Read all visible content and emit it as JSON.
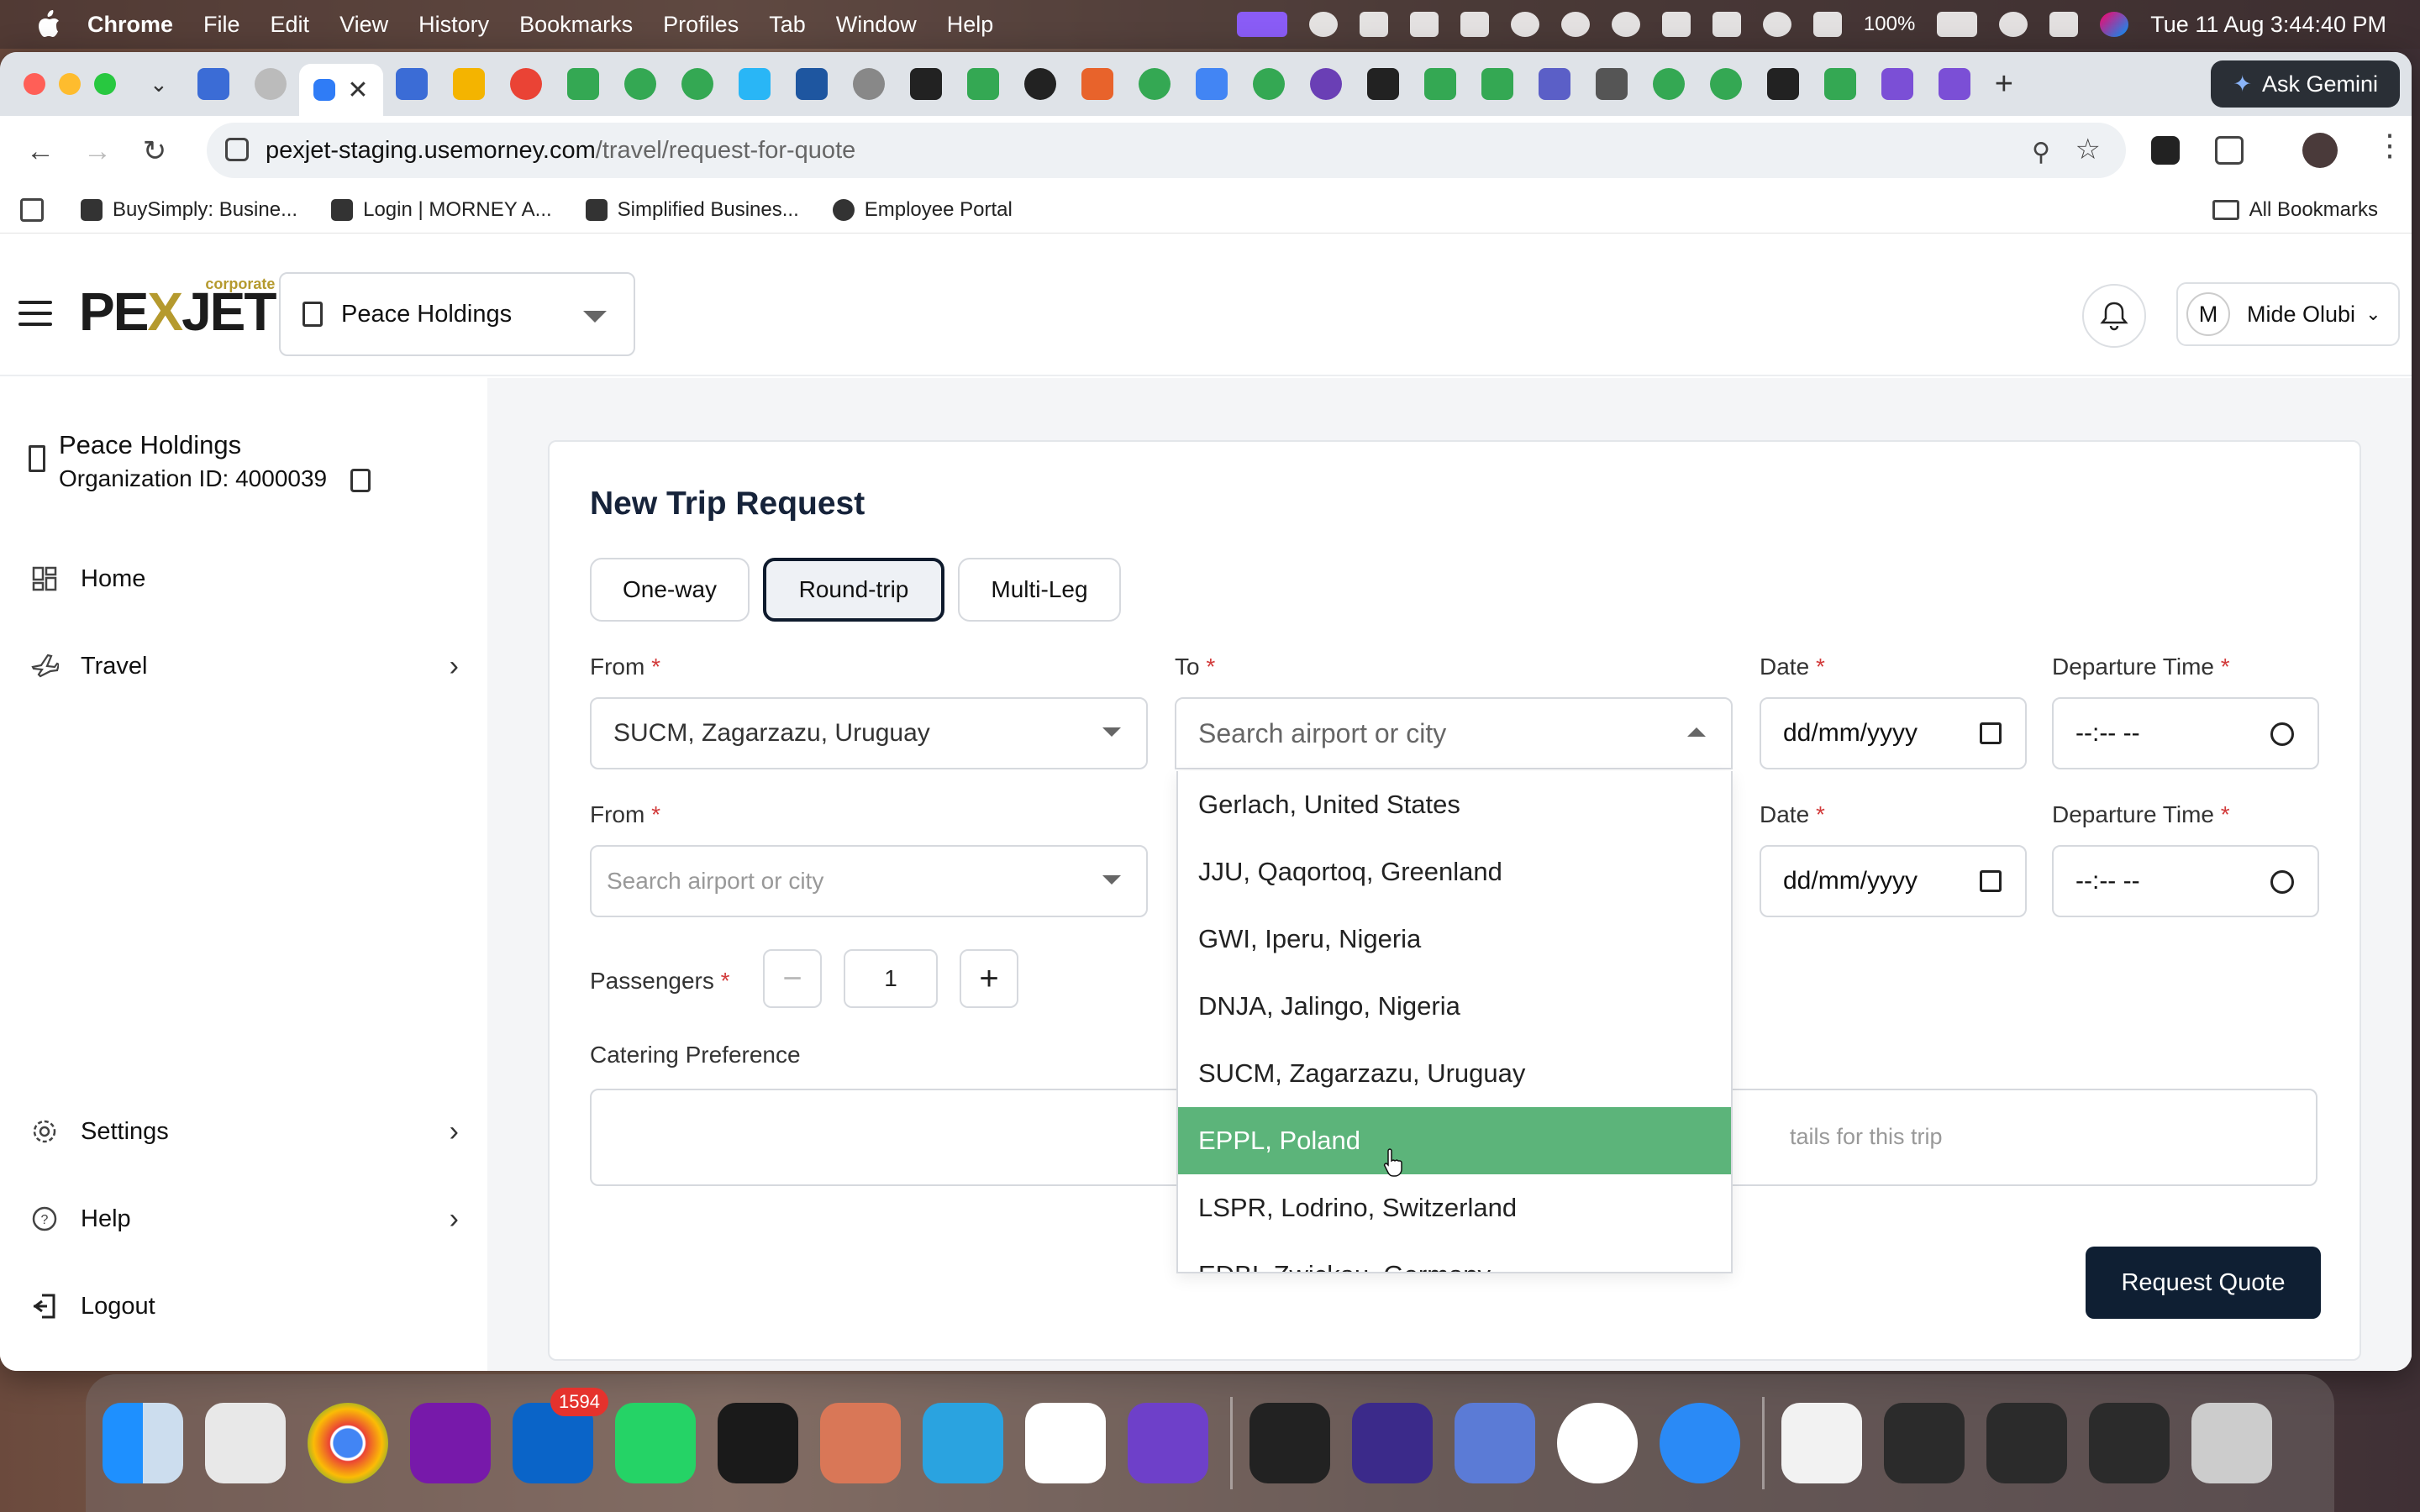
{
  "menubar": {
    "app": "Chrome",
    "items": [
      "File",
      "Edit",
      "View",
      "History",
      "Bookmarks",
      "Profiles",
      "Tab",
      "Window",
      "Help"
    ],
    "battery": "100%",
    "datetime": "Tue 11 Aug  3:44:40 PM"
  },
  "browser": {
    "ask_gemini": "Ask Gemini",
    "url_host": "pexjet-staging.usemorney.com",
    "url_path": "/travel/request-for-quote",
    "bookmarks": [
      "BuySimply: Busine...",
      "Login | MORNEY A...",
      "Simplified Busines...",
      "Employee Portal"
    ],
    "all_bookmarks": "All Bookmarks"
  },
  "header": {
    "logo_left": "PE",
    "logo_x": "X",
    "logo_right": "JET",
    "logo_tag": "corporate",
    "org_name": "Peace Holdings",
    "user_initial": "M",
    "user_name": "Mide Olubi"
  },
  "sidebar": {
    "org_name": "Peace Holdings",
    "org_id": "Organization ID: 4000039",
    "home": "Home",
    "travel": "Travel",
    "settings": "Settings",
    "help": "Help",
    "logout": "Logout"
  },
  "form": {
    "title": "New Trip Request",
    "tabs": [
      "One-way",
      "Round-trip",
      "Multi-Leg"
    ],
    "active_tab": "Round-trip",
    "from_label": "From",
    "to_label": "To",
    "date_label": "Date",
    "departure_label": "Departure Time",
    "required_mark": "*",
    "from_value": "SUCM, Zagarzazu, Uruguay",
    "to_placeholder": "Search airport or city",
    "from2_placeholder": "Search airport or city",
    "date_placeholder": "dd/mm/yyyy",
    "time_placeholder": "--:-- --",
    "passengers_label": "Passengers",
    "passengers": "1",
    "minus": "−",
    "plus": "+",
    "catering_label": "Catering Preference",
    "catering_placeholder_partial": "tails for this trip",
    "submit": "Request Quote"
  },
  "dropdown": {
    "options": [
      "Gerlach, United States",
      "JJU, Qaqortoq, Greenland",
      "GWI, Iperu, Nigeria",
      "DNJA, Jalingo, Nigeria",
      "SUCM, Zagarzazu, Uruguay",
      "EPPL, Poland",
      "LSPR, Lodrino, Switzerland",
      "EDBI, Zwickau, Germany"
    ],
    "highlighted": "EPPL, Poland"
  },
  "dock": {
    "mail_badge": "1594"
  },
  "colors": {
    "primary": "#0f1f33",
    "highlight": "#5cb47a",
    "required": "#d23b3b",
    "brand_gold": "#b59a2e"
  }
}
